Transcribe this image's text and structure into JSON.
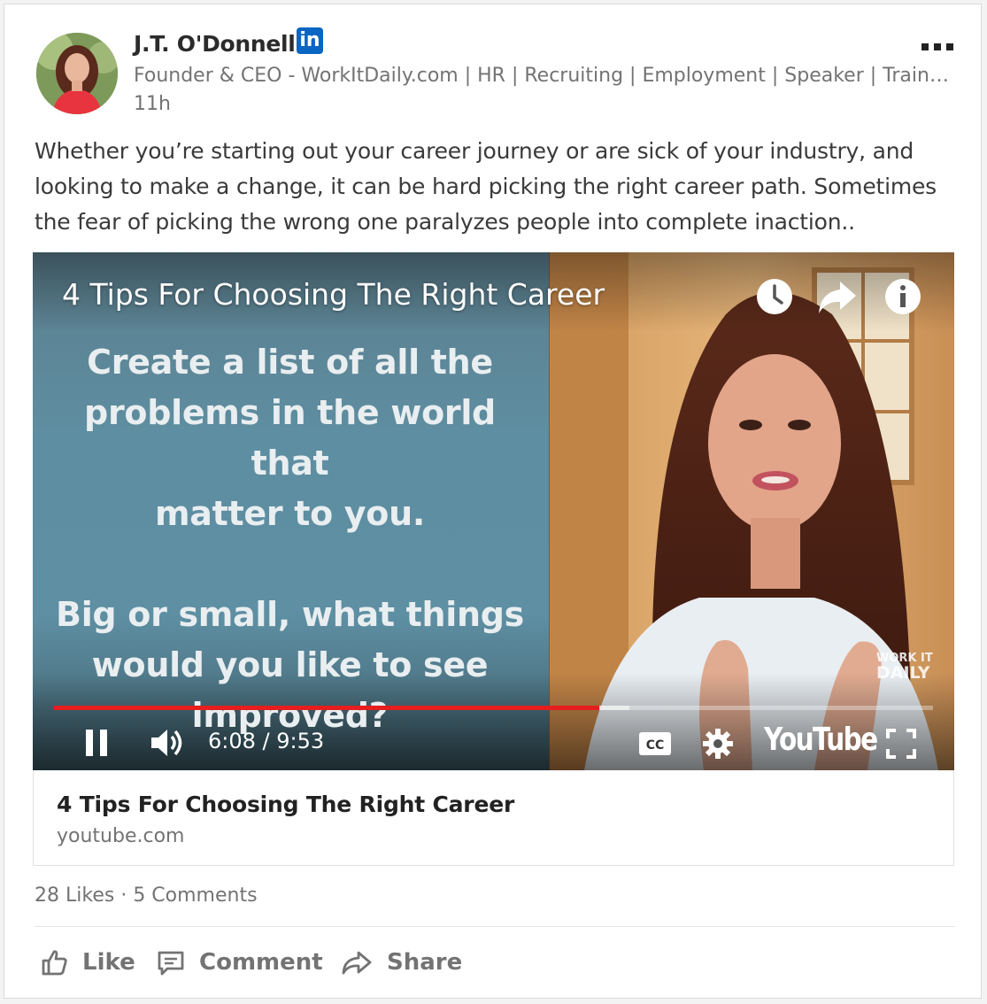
{
  "post": {
    "author_name": "J.T. O'Donnell",
    "badge": "in",
    "headline": "Founder & CEO - WorkItDaily.com | HR | Recruiting | Employment | Speaker | Trainer | Consultant",
    "time": "11h",
    "text": "Whether you’re starting out your career journey or are sick of your industry, and looking to make a change, it can be hard picking the right career path. Sometimes the fear of picking the wrong one paralyzes people into complete inaction.."
  },
  "video": {
    "title": "4 Tips For Choosing The Right Career",
    "slide_line1": "Create a list of all the",
    "slide_line2": "problems in the world that",
    "slide_line3": "matter to you.",
    "slide_line4": "Big or small, what things",
    "slide_line5": "would you like to see",
    "slide_line6": "improved?",
    "watermark_line1": "WORK IT",
    "watermark_line2": "DAILY",
    "time_readout": "6:08 / 9:53",
    "progress_played_fraction": 0.62,
    "progress_buffered_fraction": 0.655,
    "player_brand": "YouTube",
    "accent_color": "#e61e1e"
  },
  "link": {
    "title": "4 Tips For Choosing The Right Career",
    "domain": "youtube.com"
  },
  "social": {
    "likes": "28 Likes",
    "separator": "·",
    "comments": "5 Comments"
  },
  "actions": {
    "like": "Like",
    "comment": "Comment",
    "share": "Share"
  }
}
